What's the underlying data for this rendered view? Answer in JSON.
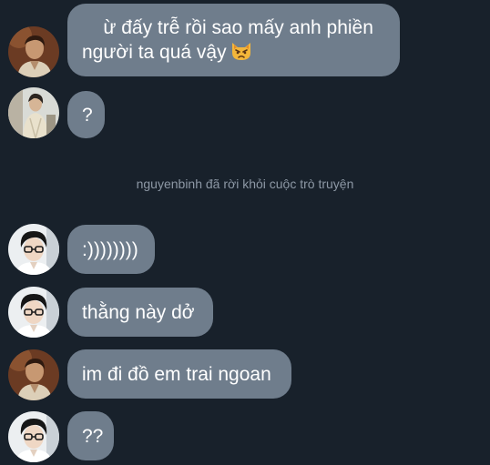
{
  "messages": [
    {
      "text": "ừ đấy trễ rồi sao mấy anh phiền người ta quá vậy",
      "emoji": "pouting-cat-emoji",
      "avatar": "avatar-warm"
    },
    {
      "text": "?",
      "avatar": "avatar-light"
    },
    {
      "text": ":))))))))",
      "avatar": "avatar-glasses"
    },
    {
      "text": "thằng này dở",
      "avatar": "avatar-glasses"
    },
    {
      "text": "im đi đồ em trai ngoan",
      "avatar": "avatar-warm"
    },
    {
      "text": "??",
      "avatar": "avatar-glasses"
    }
  ],
  "system_notice": "nguyenbinh đã rời khỏi cuộc trò truyện",
  "colors": {
    "background": "#18212b",
    "bubble": "#6f7d8c",
    "bubble_text": "#ffffff",
    "system_text": "#8d98a5"
  }
}
